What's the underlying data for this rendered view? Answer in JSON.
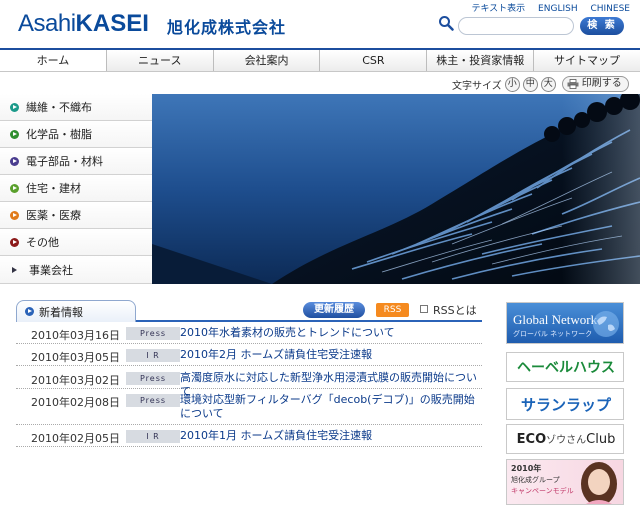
{
  "header": {
    "logo_en_plain": "Asahi",
    "logo_en_bold": "KASEI",
    "logo_jp": "旭化成株式会社",
    "links": [
      "テキスト表示",
      "ENGLISH",
      "CHINESE"
    ],
    "search_placeholder": "",
    "search_button": "検 索"
  },
  "nav": {
    "tabs": [
      "ホーム",
      "ニュース",
      "会社案内",
      "CSR",
      "株主・投資家情報",
      "サイトマップ"
    ],
    "active": "ホーム"
  },
  "fontbar": {
    "label": "文字サイズ",
    "small": "小",
    "medium": "中",
    "large": "大",
    "print": "印刷する"
  },
  "sidebar": {
    "items": [
      {
        "label": "繊維・不織布",
        "color": "#1c9a8a"
      },
      {
        "label": "化学品・樹脂",
        "color": "#2f8f2f"
      },
      {
        "label": "電子部品・材料",
        "color": "#4a3d8f"
      },
      {
        "label": "住宅・建材",
        "color": "#5aa02c"
      },
      {
        "label": "医薬・医療",
        "color": "#e07a1a"
      },
      {
        "label": "その他",
        "color": "#8c1a1a"
      },
      {
        "label": "事業会社",
        "color": "#333344"
      }
    ]
  },
  "news": {
    "heading": "新着情報",
    "update_history": "更新履歴",
    "rss": "RSS",
    "rss_about": "RSSとは",
    "items": [
      {
        "date": "2010年03月16日",
        "category": "Press",
        "title": "2010年水着素材の販売とトレンドについて"
      },
      {
        "date": "2010年03月05日",
        "category": "I R",
        "title": "2010年2月 ホームズ請負住宅受注速報"
      },
      {
        "date": "2010年03月02日",
        "category": "Press",
        "title": "高濁度原水に対応した新型浄水用浸漬式膜の販売開始について"
      },
      {
        "date": "2010年02月08日",
        "category": "Press",
        "title": "環境対応型新フィルターバグ「decob(デコブ)」の販売開始について"
      },
      {
        "date": "2010年02月05日",
        "category": "I R",
        "title": "2010年1月 ホームズ請負住宅受注速報"
      }
    ]
  },
  "banners": {
    "global_en": "Global Network",
    "global_jp": "グローバル ネットワーク",
    "hebel": "ヘーベルハウス",
    "saran": "サランラップ",
    "eco_prefix": "ECO",
    "eco_mid": "ゾウさん",
    "eco_suffix": "Club",
    "campaign_line1": "2010年",
    "campaign_line2": "旭化成グループ",
    "campaign_line3": "キャンペーンモデル"
  }
}
